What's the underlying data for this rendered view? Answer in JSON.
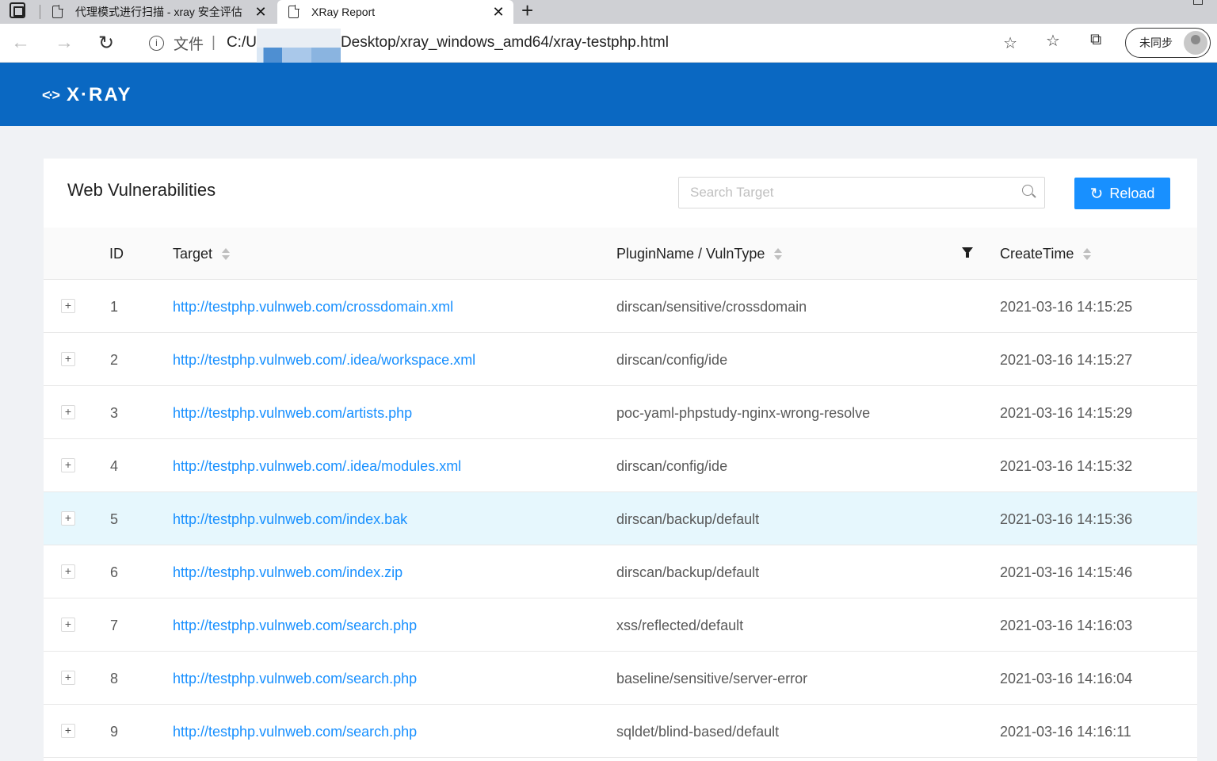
{
  "browser": {
    "tabs": [
      {
        "title": "代理模式进行扫描 - xray 安全评估",
        "close": "✕"
      },
      {
        "title": "XRay Report",
        "close": "✕"
      }
    ],
    "new_tab": "+",
    "address": {
      "scheme_label": "文件",
      "separator": "|",
      "url_prefix": "C:/U",
      "url_suffix": "Desktop/xray_windows_amd64/xray-testphp.html"
    },
    "profile_label": "未同步"
  },
  "app": {
    "logo_mark": "<·>",
    "logo_text": "X·RAY"
  },
  "card": {
    "title": "Web Vulnerabilities",
    "search_placeholder": "Search Target",
    "reload_label": "Reload"
  },
  "table": {
    "columns": [
      "ID",
      "Target",
      "PluginName / VulnType",
      "CreateTime"
    ],
    "rows": [
      {
        "id": "1",
        "target": "http://testphp.vulnweb.com/crossdomain.xml",
        "plugin": "dirscan/sensitive/crossdomain",
        "time": "2021-03-16 14:15:25"
      },
      {
        "id": "2",
        "target": "http://testphp.vulnweb.com/.idea/workspace.xml",
        "plugin": "dirscan/config/ide",
        "time": "2021-03-16 14:15:27"
      },
      {
        "id": "3",
        "target": "http://testphp.vulnweb.com/artists.php",
        "plugin": "poc-yaml-phpstudy-nginx-wrong-resolve",
        "time": "2021-03-16 14:15:29"
      },
      {
        "id": "4",
        "target": "http://testphp.vulnweb.com/.idea/modules.xml",
        "plugin": "dirscan/config/ide",
        "time": "2021-03-16 14:15:32"
      },
      {
        "id": "5",
        "target": "http://testphp.vulnweb.com/index.bak",
        "plugin": "dirscan/backup/default",
        "time": "2021-03-16 14:15:36"
      },
      {
        "id": "6",
        "target": "http://testphp.vulnweb.com/index.zip",
        "plugin": "dirscan/backup/default",
        "time": "2021-03-16 14:15:46"
      },
      {
        "id": "7",
        "target": "http://testphp.vulnweb.com/search.php",
        "plugin": "xss/reflected/default",
        "time": "2021-03-16 14:16:03"
      },
      {
        "id": "8",
        "target": "http://testphp.vulnweb.com/search.php",
        "plugin": "baseline/sensitive/server-error",
        "time": "2021-03-16 14:16:04"
      },
      {
        "id": "9",
        "target": "http://testphp.vulnweb.com/search.php",
        "plugin": "sqldet/blind-based/default",
        "time": "2021-03-16 14:16:11"
      }
    ],
    "expand_symbol": "+"
  },
  "colors": {
    "header_bg": "#0a68c2",
    "accent": "#1890ff",
    "row_highlight": "#e6f7fd"
  }
}
